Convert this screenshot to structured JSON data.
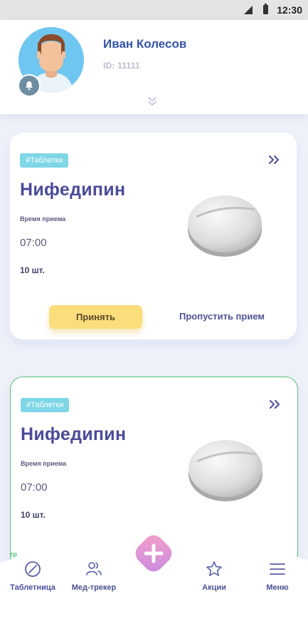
{
  "status_bar": {
    "time": "12:30"
  },
  "profile": {
    "name": "Иван Колесов",
    "id_text": "ID: 11111",
    "avatar_icon": "user-avatar",
    "bell_icon": "bell-icon",
    "expand_icon": "double-chevron-down-icon"
  },
  "cards": [
    {
      "tag": "#Таблетки",
      "drug": "Нифедипин",
      "time_label": "Время приема",
      "time": "07:00",
      "quantity": "10 шт.",
      "take_label": "Принять",
      "skip_label": "Пропустить прием",
      "highlighted": false
    },
    {
      "tag": "#Таблетки",
      "drug": "Нифедипин",
      "time_label": "Время приема",
      "time": "07:00",
      "quantity": "10 шт.",
      "partial_text": "тр",
      "highlighted": true
    }
  ],
  "nav": {
    "items": [
      {
        "label": "Таблетница",
        "icon": "pill-icon",
        "active": true
      },
      {
        "label": "Мед-трекер",
        "icon": "users-icon",
        "active": false
      },
      {
        "label": "Акции",
        "icon": "star-icon",
        "active": false
      },
      {
        "label": "Меню",
        "icon": "menu-icon",
        "active": false
      }
    ],
    "fab_icon": "plus-icon"
  },
  "colors": {
    "primary_text": "#4b4b9a",
    "tag_bg": "#7ed6e6",
    "take_button": "#fbdd7c",
    "highlight_border": "#57c07a",
    "fab_gradient_start": "#f5a0c8",
    "fab_gradient_end": "#c88ae0"
  }
}
